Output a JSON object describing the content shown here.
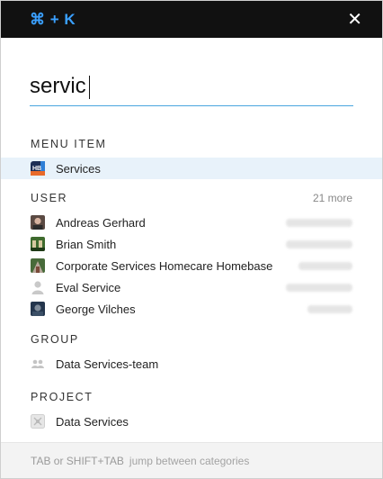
{
  "topbar": {
    "shortcut": "⌘ + K",
    "close_icon": "close-icon"
  },
  "search": {
    "value": "servic",
    "placeholder": ""
  },
  "sections": {
    "menu": {
      "title": "MENU ITEM",
      "items": [
        {
          "label": "Services",
          "icon": "hb-logo-icon"
        }
      ]
    },
    "user": {
      "title": "USER",
      "more": "21 more",
      "items": [
        {
          "label": "Andreas Gerhard",
          "icon": "avatar-andreas"
        },
        {
          "label": "Brian Smith",
          "icon": "avatar-brian"
        },
        {
          "label": "Corporate Services Homecare Homebase",
          "icon": "avatar-corporate"
        },
        {
          "label": "Eval Service",
          "icon": "avatar-default"
        },
        {
          "label": "George Vilches",
          "icon": "avatar-george"
        }
      ]
    },
    "group": {
      "title": "GROUP",
      "items": [
        {
          "label": "Data Services-team",
          "icon": "group-icon"
        }
      ]
    },
    "project": {
      "title": "PROJECT",
      "items": [
        {
          "label": "Data Services",
          "icon": "project-icon"
        }
      ]
    }
  },
  "footer": {
    "keys": "TAB or SHIFT+TAB",
    "hint": "jump between categories"
  },
  "colors": {
    "accent": "#3aa0ff",
    "selected_bg": "#e8f2fa",
    "topbar_bg": "#111111"
  }
}
